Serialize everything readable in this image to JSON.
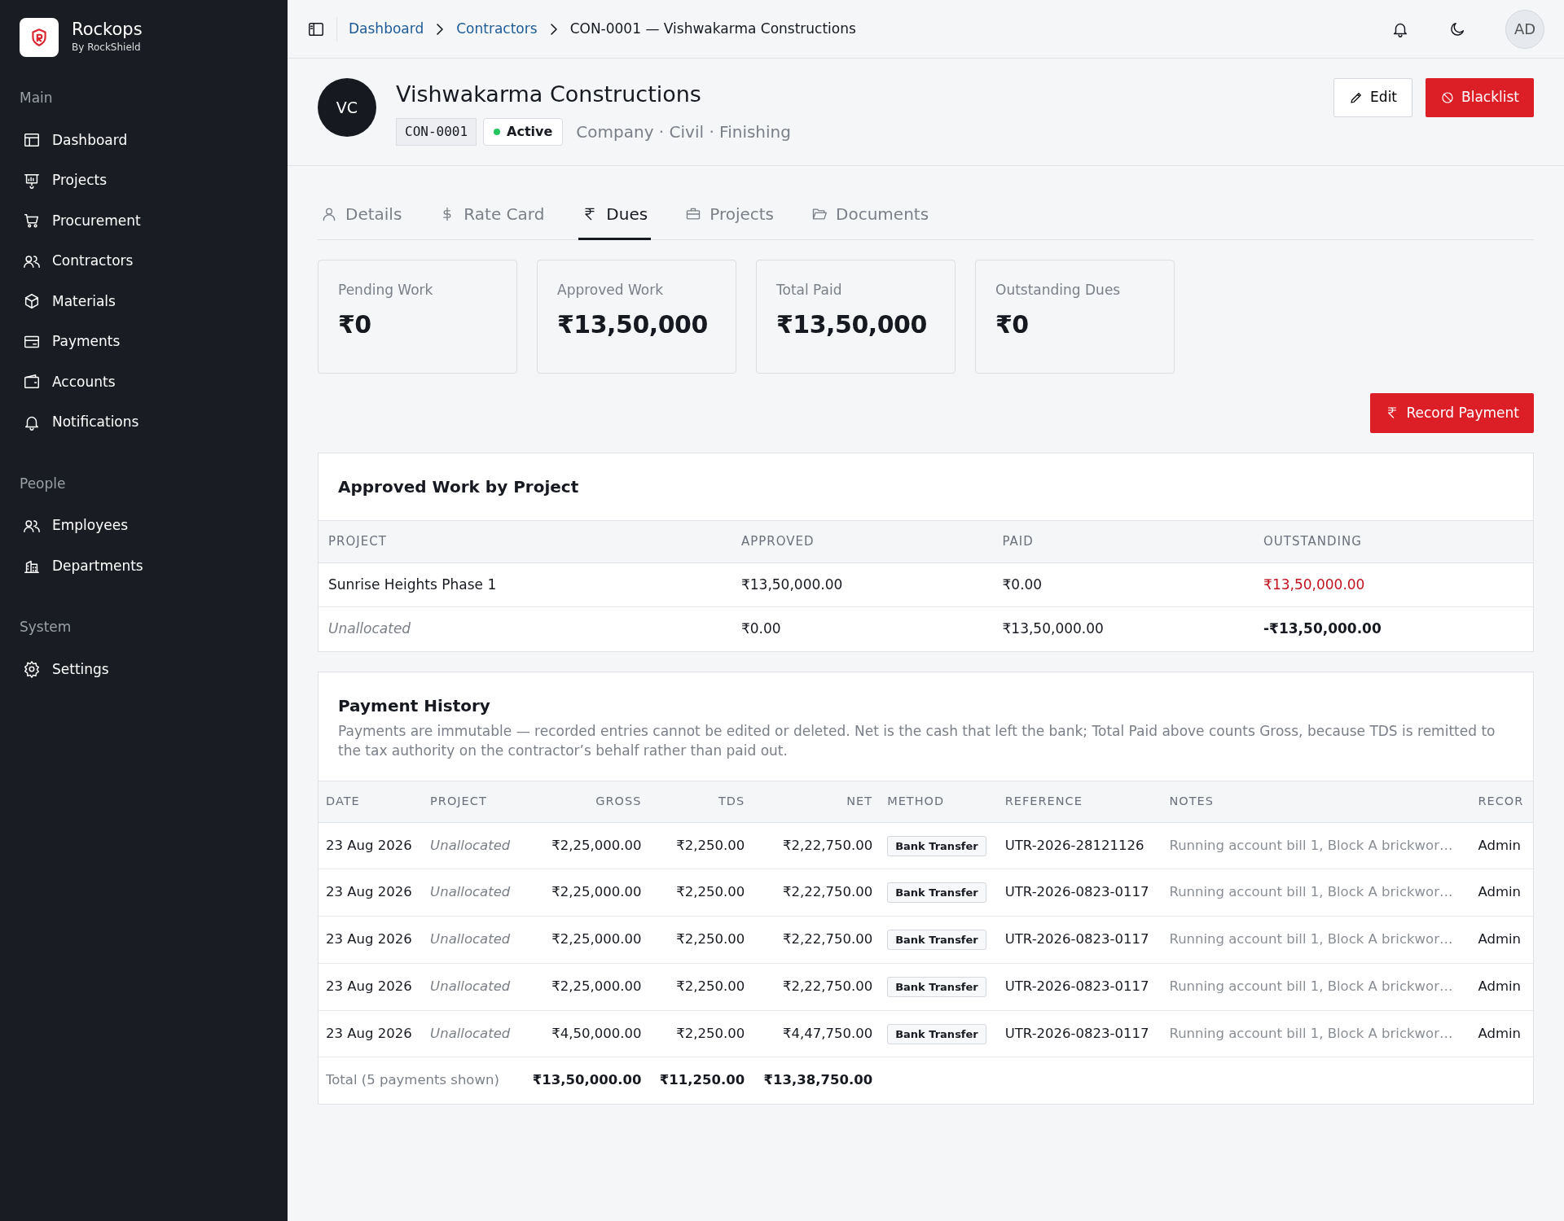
{
  "brand": {
    "name": "Rockops",
    "tagline": "By RockShield"
  },
  "sidebar": {
    "sections": [
      {
        "title": "Main",
        "items": [
          "Dashboard",
          "Projects",
          "Procurement",
          "Contractors",
          "Materials",
          "Payments",
          "Accounts",
          "Notifications"
        ]
      },
      {
        "title": "People",
        "items": [
          "Employees",
          "Departments"
        ]
      },
      {
        "title": "System",
        "items": [
          "Settings"
        ]
      }
    ]
  },
  "breadcrumb": [
    {
      "label": "Dashboard",
      "link": true
    },
    {
      "label": "Contractors",
      "link": true
    },
    {
      "label": "CON-0001 — Vishwakarma Constructions",
      "link": false
    }
  ],
  "user_initials": "AD",
  "contractor": {
    "initials": "VC",
    "name": "Vishwakarma Constructions",
    "code": "CON-0001",
    "status": "Active",
    "meta": "Company · Civil · Finishing"
  },
  "actions": [
    "Edit",
    "Blacklist"
  ],
  "tabs": [
    {
      "label": "Details",
      "selected": false
    },
    {
      "label": "Rate Card",
      "selected": false
    },
    {
      "label": "Dues",
      "selected": true
    },
    {
      "label": "Projects",
      "selected": false
    },
    {
      "label": "Documents",
      "selected": false
    }
  ],
  "stats": [
    {
      "label": "Pending Work",
      "value": "₹0"
    },
    {
      "label": "Approved Work",
      "value": "₹13,50,000"
    },
    {
      "label": "Total Paid",
      "value": "₹13,50,000"
    },
    {
      "label": "Outstanding Dues",
      "value": "₹0"
    }
  ],
  "record_button": "Record Payment",
  "approved": {
    "title": "Approved Work by Project",
    "columns": [
      "PROJECT",
      "APPROVED",
      "PAID",
      "OUTSTANDING"
    ],
    "rows": [
      {
        "project": "Sunrise Heights Phase 1",
        "unallocated": false,
        "approved": "₹13,50,000.00",
        "paid": "₹0.00",
        "outstanding": "₹13,50,000.00",
        "kind": "due"
      },
      {
        "project": "Unallocated",
        "unallocated": true,
        "approved": "₹0.00",
        "paid": "₹13,50,000.00",
        "outstanding": "-₹13,50,000.00",
        "kind": "credit"
      }
    ]
  },
  "history": {
    "title": "Payment History",
    "description": "Payments are immutable — recorded entries cannot be edited or deleted. Net is the cash that left the bank; Total Paid above counts Gross, because TDS is remitted to the tax authority on the contractor’s behalf rather than paid out.",
    "columns": [
      "DATE",
      "PROJECT",
      "GROSS",
      "TDS",
      "NET",
      "METHOD",
      "REFERENCE",
      "NOTES",
      "RECOR"
    ],
    "rows": [
      {
        "date": "23 Aug 2026",
        "project": "Unallocated",
        "gross": "₹2,25,000.00",
        "tds": "₹2,250.00",
        "net": "₹2,22,750.00",
        "method": "Bank Transfer",
        "reference": "UTR-2026-28121126",
        "notes": "Running account bill 1, Block A brickwor…",
        "recorded_by": "Admin"
      },
      {
        "date": "23 Aug 2026",
        "project": "Unallocated",
        "gross": "₹2,25,000.00",
        "tds": "₹2,250.00",
        "net": "₹2,22,750.00",
        "method": "Bank Transfer",
        "reference": "UTR-2026-0823-0117",
        "notes": "Running account bill 1, Block A brickwor…",
        "recorded_by": "Admin"
      },
      {
        "date": "23 Aug 2026",
        "project": "Unallocated",
        "gross": "₹2,25,000.00",
        "tds": "₹2,250.00",
        "net": "₹2,22,750.00",
        "method": "Bank Transfer",
        "reference": "UTR-2026-0823-0117",
        "notes": "Running account bill 1, Block A brickwor…",
        "recorded_by": "Admin"
      },
      {
        "date": "23 Aug 2026",
        "project": "Unallocated",
        "gross": "₹2,25,000.00",
        "tds": "₹2,250.00",
        "net": "₹2,22,750.00",
        "method": "Bank Transfer",
        "reference": "UTR-2026-0823-0117",
        "notes": "Running account bill 1, Block A brickwor…",
        "recorded_by": "Admin"
      },
      {
        "date": "23 Aug 2026",
        "project": "Unallocated",
        "gross": "₹4,50,000.00",
        "tds": "₹2,250.00",
        "net": "₹4,47,750.00",
        "method": "Bank Transfer",
        "reference": "UTR-2026-0823-0117",
        "notes": "Running account bill 1, Block A brickwor…",
        "recorded_by": "Admin"
      }
    ],
    "total": {
      "label": "Total (5 payments shown)",
      "gross": "₹13,50,000.00",
      "tds": "₹11,250.00",
      "net": "₹13,38,750.00"
    }
  }
}
